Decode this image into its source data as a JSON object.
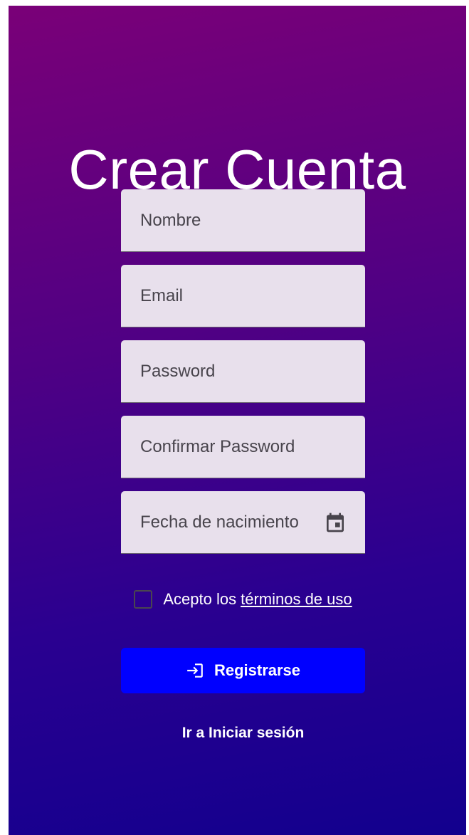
{
  "page": {
    "title": "Crear Cuenta"
  },
  "form": {
    "fields": [
      {
        "placeholder": "Nombre",
        "value": ""
      },
      {
        "placeholder": "Email",
        "value": ""
      },
      {
        "placeholder": "Password",
        "value": ""
      },
      {
        "placeholder": "Confirmar Password",
        "value": ""
      },
      {
        "placeholder": "Fecha de nacimiento",
        "value": "",
        "icon": "calendar-icon"
      }
    ],
    "terms": {
      "checked": false,
      "prefix": "Acepto los",
      "link": "términos de uso"
    },
    "register_button": {
      "label": "Registrarse",
      "icon": "login-icon"
    },
    "login_link": "Ir a Iniciar sesión"
  },
  "colors": {
    "gradient_top": "#7a0078",
    "gradient_bottom": "#12008e",
    "field_bg": "#e8e0ec",
    "button_bg": "#0000ff",
    "text": "#ffffff"
  }
}
